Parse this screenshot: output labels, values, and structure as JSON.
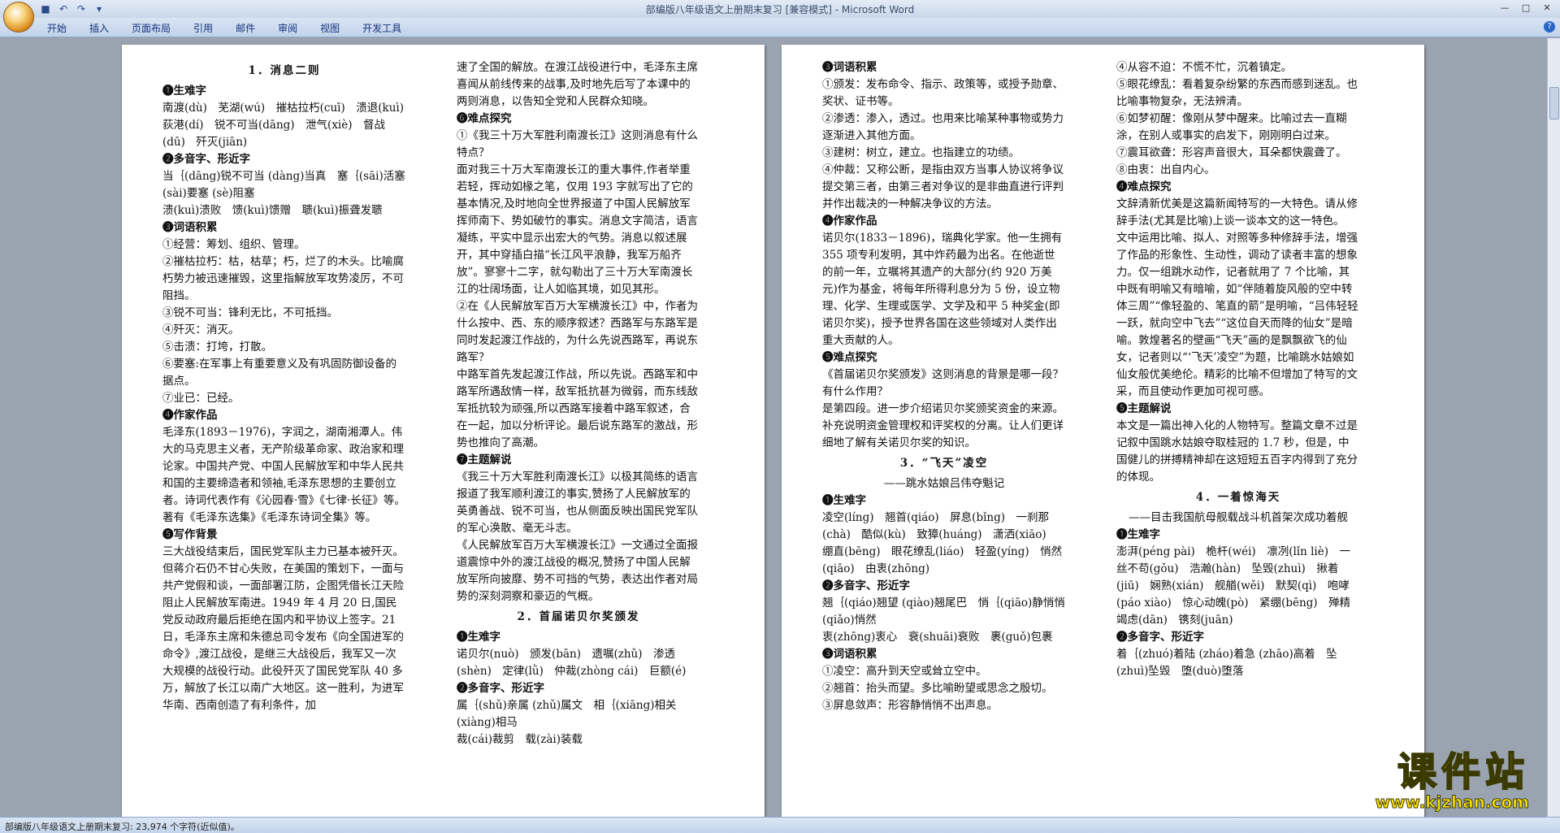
{
  "window": {
    "title": "部编版八年级语文上册期末复习 [兼容模式] - Microsoft Word"
  },
  "ribbon": {
    "tabs": [
      "开始",
      "插入",
      "页面布局",
      "引用",
      "邮件",
      "审阅",
      "视图",
      "开发工具"
    ]
  },
  "status": {
    "text": "部编版八年级语文上册期末复习: 23,974 个字符(近似值)。"
  },
  "watermark": {
    "logo": "课件站",
    "url": "www.kjzhan.com"
  },
  "page1": {
    "col1": [
      {
        "t": "1．消息二则",
        "c": "title"
      },
      {
        "t": "❶生难字",
        "c": "h"
      },
      {
        "t": "南渡(dù)　芜湖(wú)　摧枯拉朽(cuī)　溃退(kuì)　荻港(dí)　锐不可当(dāng)　泄气(xiè)　督战(dū)　歼灭(jiān)"
      },
      {
        "t": "❷多音字、形近字",
        "c": "h"
      },
      {
        "t": "当｛(dāng)锐不可当 (dàng)当真　塞｛(sāi)活塞 (sài)要塞 (sè)阻塞"
      },
      {
        "t": "溃(kuì)溃败　馈(kuì)馈赠　聩(kuì)振聋发聩"
      },
      {
        "t": "❸词语积累",
        "c": "h"
      },
      {
        "t": "①经营：筹划、组织、管理。"
      },
      {
        "t": "②摧枯拉朽：枯，枯草；朽，烂了的木头。比喻腐朽势力被迅速摧毁，这里指解放军攻势凌厉，不可阻挡。"
      },
      {
        "t": "③锐不可当：锋利无比，不可抵挡。"
      },
      {
        "t": "④歼灭：消灭。"
      },
      {
        "t": "⑤击溃：打垮，打散。"
      },
      {
        "t": "⑥要塞:在军事上有重要意义及有巩固防御设备的据点。"
      },
      {
        "t": "⑦业已：已经。"
      },
      {
        "t": "❹作家作品",
        "c": "h"
      },
      {
        "t": "毛泽东(1893－1976)，字润之，湖南湘潭人。伟大的马克思主义者，无产阶级革命家、政治家和理论家。中国共产党、中国人民解放军和中华人民共和国的主要缔造者和领袖,毛泽东思想的主要创立者。诗词代表作有《沁园春·雪》《七律·长征》等。著有《毛泽东选集》《毛泽东诗词全集》等。"
      },
      {
        "t": "❺写作背景",
        "c": "h"
      },
      {
        "t": "三大战役结束后，国民党军队主力已基本被歼灭。但蒋介石仍不甘心失败，在美国的策划下，一面与共产党假和谈，一面部署江防，企图凭借长江天险阻止人民解放军南进。1949 年 4 月 20 日,国民党反动政府最后拒绝在国内和平协议上签字。21 日，毛泽东主席和朱德总司令发布《向全国进军的命令》,渡江战役，是继三大战役后，我军又一次大规模的战役行动。此役歼灭了国民党军队 40 多万，解放了长江以南广大地区。这一胜利，为进军华南、西南创造了有利条件，加"
      }
    ],
    "col2": [
      {
        "t": "速了全国的解放。在渡江战役进行中，毛泽东主席喜闻从前线传来的战事,及时地先后写了本课中的两则消息，以告知全党和人民群众知晓。"
      },
      {
        "t": "❻难点探究",
        "c": "h"
      },
      {
        "t": "①《我三十万大军胜利南渡长江》这则消息有什么特点？"
      },
      {
        "t": "面对我三十万大军南渡长江的重大事件,作者举重若轻，挥动如椽之笔，仅用 193 字就写出了它的基本情况,及时地向全世界报道了中国人民解放军挥师南下、势如破竹的事实。消息文字简洁，语言凝练，平实中显示出宏大的气势。消息以叙述展开，其中穿插白描“长江风平浪静，我军万船齐放”。寥寥十二字，就勾勒出了三十万大军南渡长江的壮阔场面，让人如临其境，如见其形。"
      },
      {
        "t": "②在《人民解放军百万大军横渡长江》中，作者为什么按中、西、东的顺序叙述？西路军与东路军是同时发起渡江作战的，为什么先说西路军，再说东路军？"
      },
      {
        "t": "中路军首先发起渡江作战，所以先说。西路军和中路军所遇敌情一样，敌军抵抗甚为微弱，而东线敌军抵抗较为顽强,所以西路军接着中路军叙述，合在一起，加以分析评论。最后说东路军的激战，形势也推向了高潮。"
      },
      {
        "t": "❼主题解说",
        "c": "h"
      },
      {
        "t": "《我三十万大军胜利南渡长江》以极其简练的语言报道了我军顺利渡江的事实,赞扬了人民解放军的英勇善战、锐不可当，也从侧面反映出国民党军队的军心涣散、毫无斗志。"
      },
      {
        "t": "《人民解放军百万大军横渡长江》一文通过全面报道震惊中外的渡江战役的概况,赞扬了中国人民解放军所向披靡、势不可挡的气势，表达出作者对局势的深刻洞察和豪迈的气概。"
      },
      {
        "t": "2．首届诺贝尔奖颁发",
        "c": "title"
      },
      {
        "t": "❶生难字",
        "c": "h"
      },
      {
        "t": "诺贝尔(nuò)　颁发(bān)　遗嘱(zhǔ)　渗透(shèn)　定律(lǜ)　仲裁(zhòng cái)　巨额(é)"
      },
      {
        "t": "❷多音字、形近字",
        "c": "h"
      },
      {
        "t": "属｛(shǔ)亲属 (zhǔ)属文　相｛(xiāng)相关 (xiàng)相马"
      },
      {
        "t": "裁(cái)裁剪　载(zài)装载"
      }
    ]
  },
  "page2": {
    "col1": [
      {
        "t": "❸词语积累",
        "c": "h"
      },
      {
        "t": "①颁发：发布命令、指示、政策等，或授予勋章、奖状、证书等。"
      },
      {
        "t": "②渗透：渗入，透过。也用来比喻某种事物或势力逐渐进入其他方面。"
      },
      {
        "t": "③建树：树立，建立。也指建立的功绩。"
      },
      {
        "t": "④仲裁：又称公断，是指由双方当事人协议将争议提交第三者，由第三者对争议的是非曲直进行评判并作出裁决的一种解决争议的方法。"
      },
      {
        "t": "❹作家作品",
        "c": "h"
      },
      {
        "t": "诺贝尔(1833－1896)，瑞典化学家。他一生拥有 355 项专利发明，其中炸药最为出名。在他逝世的前一年，立嘱将其遗产的大部分(约 920 万美元)作为基金，将每年所得利息分为 5 份，设立物理、化学、生理或医学、文学及和平 5 种奖金(即诺贝尔奖)，授予世界各国在这些领域对人类作出重大贡献的人。"
      },
      {
        "t": "❺难点探究",
        "c": "h"
      },
      {
        "t": "《首届诺贝尔奖颁发》这则消息的背景是哪一段？有什么作用？"
      },
      {
        "t": "是第四段。进一步介绍诺贝尔奖颁奖资金的来源。补充说明资金管理权和评奖权的分离。让人们更详细地了解有关诺贝尔奖的知识。"
      },
      {
        "t": "3．“飞天”凌空",
        "c": "title"
      },
      {
        "t": "——跳水姑娘吕伟夺魁记",
        "c": "center"
      },
      {
        "t": "❶生难字",
        "c": "h"
      },
      {
        "t": "凌空(líng)　翘首(qiáo)　屏息(bǐng)　一刹那(chà)　酷似(kù)　致獐(huáng)　潇洒(xiāo)　绷直(bēng)　眼花缭乱(liáo)　轻盈(yíng)　悄然(qiāo)　由衷(zhōng)"
      },
      {
        "t": "❷多音字、形近字",
        "c": "h"
      },
      {
        "t": "翘｛(qiáo)翘望 (qiào)翘尾巴　悄｛(qiāo)静悄悄 (qiǎo)悄然"
      },
      {
        "t": "衷(zhōng)衷心　衰(shuāi)衰败　裹(guǒ)包裹"
      },
      {
        "t": "❸词语积累",
        "c": "h"
      },
      {
        "t": "①凌空：高升到天空或耸立空中。"
      },
      {
        "t": "②翘首：抬头而望。多比喻盼望或思念之殷切。"
      },
      {
        "t": "③屏息敛声：形容静悄悄不出声息。"
      }
    ],
    "col2": [
      {
        "t": "④从容不迫：不慌不忙，沉着镇定。"
      },
      {
        "t": "⑤眼花缭乱：看着复杂纷繁的东西而感到迷乱。也比喻事物复杂，无法辨清。"
      },
      {
        "t": "⑥如梦初醒：像刚从梦中醒来。比喻过去一直糊涂，在别人或事实的启发下，刚刚明白过来。"
      },
      {
        "t": "⑦震耳欲聋：形容声音很大，耳朵都快震聋了。"
      },
      {
        "t": "⑧由衷：出自内心。"
      },
      {
        "t": "❹难点探究",
        "c": "h"
      },
      {
        "t": "文辞清新优美是这篇新闻特写的一大特色。请从修辞手法(尤其是比喻)上谈一谈本文的这一特色。"
      },
      {
        "t": "文中运用比喻、拟人、对照等多种修辞手法，增强了作品的形象性、生动性，调动了读者丰富的想象力。仅一组跳水动作，记者就用了 7 个比喻，其中既有明喻又有暗喻，如“伴随着旋风般的空中转体三周”“像轻盈的、笔直的箭”是明喻，“吕伟轻轻一跃，就向空中飞去”“这位自天而降的仙女”是暗喻。敦煌著名的壁画“飞天”画的是飘飘欲飞的仙女，记者则以“‘飞天’凌空”为题，比喻跳水姑娘如仙女般优美绝伦。精彩的比喻不但增加了特写的文采，而且使动作更加可视可感。"
      },
      {
        "t": "❺主题解说",
        "c": "h"
      },
      {
        "t": "本文是一篇出神入化的人物特写。整篇文章不过是记叙中国跳水姑娘夺取桂冠的 1.7 秒，但是，中国健儿的拼搏精神却在这短短五百字内得到了充分的体现。"
      },
      {
        "t": "4．一着惊海天",
        "c": "title"
      },
      {
        "t": "——目击我国航母舰载战斗机首架次成功着舰",
        "c": "center"
      },
      {
        "t": "❶生难字",
        "c": "h"
      },
      {
        "t": "澎湃(péng pài)　桅杆(wéi)　凛冽(lǐn liè)　一丝不苟(gǒu)　浩瀚(hàn)　坠毁(zhuì)　揪着(jiū)　娴熟(xián)　舰艏(wěi)　默契(qì)　咆哮(páo xiào)　惊心动魄(pò)　紧绷(bēng)　殚精竭虑(dān)　镌刻(juān)"
      },
      {
        "t": "❷多音字、形近字",
        "c": "h"
      },
      {
        "t": "着｛(zhuó)着陆 (zháo)着急 (zhāo)高着　坠(zhuì)坠毁　堕(duò)堕落"
      }
    ]
  }
}
